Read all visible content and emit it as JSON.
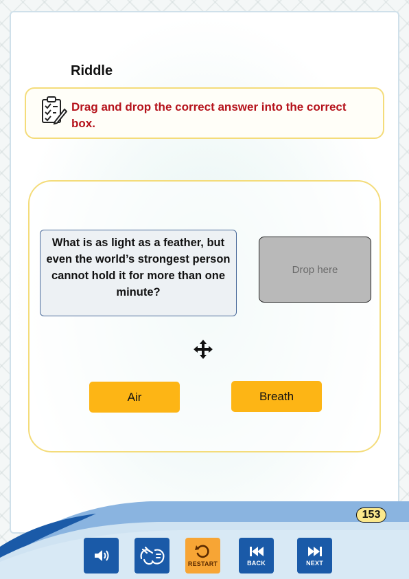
{
  "activity": {
    "title": "Riddle",
    "instruction": "Drag and drop the correct answer into the correct box.",
    "question": "What is as light as a feather, but even the world’s strongest person cannot hold it for more than one minute?",
    "drop_placeholder": "Drop here",
    "answers": [
      "Air",
      "Breath"
    ]
  },
  "footer": {
    "page_number": "153",
    "buttons": {
      "restart": "RESTART",
      "back": "BACK",
      "next": "NEXT"
    }
  },
  "colors": {
    "instruction_text": "#b5121b",
    "answer_button": "#fdb515",
    "nav_blue": "#1a5aa8",
    "nav_orange": "#f7a535",
    "box_border": "#f4dc7a"
  }
}
